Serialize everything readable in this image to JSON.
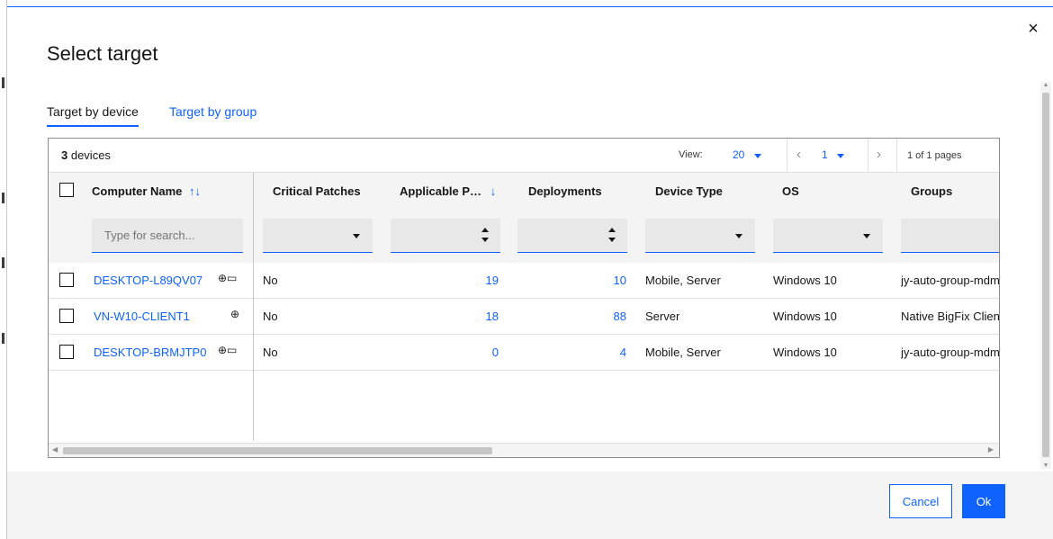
{
  "dialog": {
    "title": "Select target",
    "close_symbol": "×"
  },
  "tabs": [
    {
      "label": "Target by device",
      "active": true
    },
    {
      "label": "Target by group",
      "active": false
    }
  ],
  "toolbar": {
    "device_count": "3",
    "device_count_suffix": " devices",
    "view_label": "View:",
    "view_value": "20",
    "page_value": "1",
    "page_info": "1 of 1 pages",
    "prev_symbol": "‹",
    "next_symbol": "›"
  },
  "columns": {
    "computer_name": "Computer Name",
    "computer_name_sort": "↑↓",
    "critical_patches": "Critical Patches",
    "applicable_patches": "Applicable P…",
    "applicable_sort": "↓",
    "deployments": "Deployments",
    "device_type": "Device Type",
    "os": "OS",
    "groups": "Groups"
  },
  "search": {
    "placeholder": "Type for search..."
  },
  "rows": [
    {
      "name": "DESKTOP-L89QV07",
      "icons": "⊕▭",
      "critical": "No",
      "applicable": "19",
      "deployments": "10",
      "device_type": "Mobile, Server",
      "os": "Windows 10",
      "groups": "jy-auto-group-mdm"
    },
    {
      "name": "VN-W10-CLIENT1",
      "icons": "⊕",
      "critical": "No",
      "applicable": "18",
      "deployments": "88",
      "device_type": "Server",
      "os": "Windows 10",
      "groups": "Native BigFix Client"
    },
    {
      "name": "DESKTOP-BRMJTP0",
      "icons": "⊕▭",
      "critical": "No",
      "applicable": "0",
      "deployments": "4",
      "device_type": "Mobile, Server",
      "os": "Windows 10",
      "groups": "jy-auto-group-mdm"
    }
  ],
  "footer": {
    "cancel_label": "Cancel",
    "ok_label": "Ok"
  },
  "colors": {
    "accent": "#0f62fe",
    "header_bg": "#f4f4f4",
    "text": "#161616"
  }
}
